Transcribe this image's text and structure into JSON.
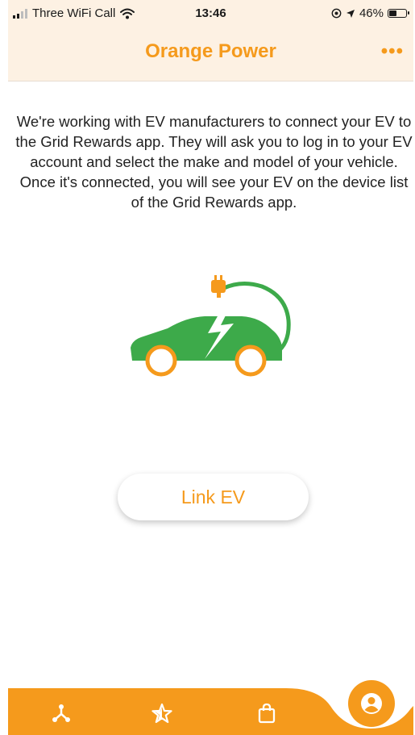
{
  "status_bar": {
    "carrier": "Three WiFi Call",
    "time": "13:46",
    "battery_percent": "46%",
    "battery_level": 0.46
  },
  "header": {
    "title": "Orange Power",
    "more_label": "•••"
  },
  "main": {
    "intro_text": "We're working with EV manufacturers to connect your EV to the Grid Rewards app. They will ask you to log in to your EV account and select the make and model of your vehicle. Once it's connected, you will see your EV on the device list of the Grid Rewards app.",
    "illustration_icon": "ev-charging-car-icon",
    "link_button_label": "Link EV"
  },
  "bottom_nav": {
    "items": [
      {
        "icon": "network-icon"
      },
      {
        "icon": "star-icon"
      },
      {
        "icon": "shopping-bag-icon"
      },
      {
        "icon": "profile-icon"
      }
    ]
  },
  "colors": {
    "accent": "#f59a1c",
    "header_bg": "#fdf1e3",
    "car_green": "#3daa4a"
  }
}
